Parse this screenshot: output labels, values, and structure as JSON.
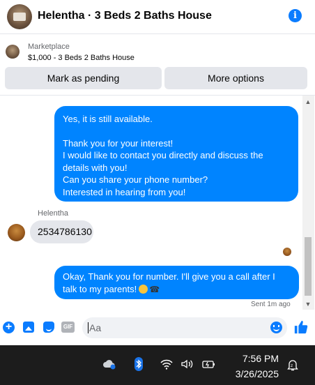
{
  "header": {
    "title": "Helentha · 3 Beds 2 Baths House"
  },
  "listing": {
    "label": "Marketplace",
    "item": "$1,000 - 3 Beds 2 Baths House"
  },
  "actions": {
    "pending_label": "Mark as pending",
    "more_label": "More options"
  },
  "messages": {
    "first": {
      "line1": "Yes, it is still available.",
      "line2": "Thank you for your interest!",
      "line3": "I would like to contact you directly and discuss the",
      "line4": "details with you!",
      "line5": "Can you share your phone number?",
      "line6": "Interested in hearing from you!"
    },
    "sender_name": "Helentha",
    "reply": "2534786130",
    "second": "Okay, Thank you for number. I'll give you a call after I talk to my parents!",
    "status": "Sent 1m ago"
  },
  "composer": {
    "placeholder": "Aa",
    "gif_label": "GIF"
  },
  "taskbar": {
    "time": "7:56 PM",
    "date": "3/26/2025"
  },
  "colors": {
    "accent": "#0084ff",
    "icon_blue": "#0a7cff",
    "taskbar": "#1c1c1c"
  }
}
